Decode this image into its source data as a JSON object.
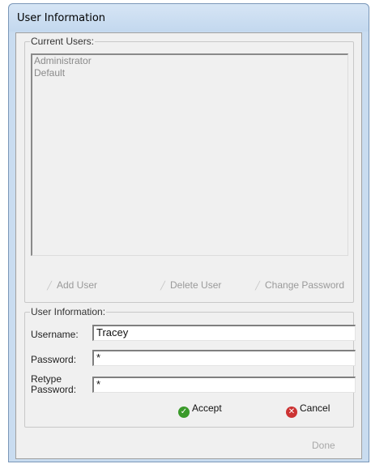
{
  "window": {
    "title": "User Information"
  },
  "users_group": {
    "legend": "Current Users:",
    "users": [
      "Administrator",
      "Default"
    ],
    "buttons": {
      "add_user": {
        "label": "Add User",
        "enabled": false
      },
      "delete_user": {
        "label": "Delete User",
        "enabled": false
      },
      "change_password": {
        "label": "Change Password",
        "enabled": false
      }
    }
  },
  "info_group": {
    "legend": "User Information:",
    "username": {
      "label": "Username:",
      "value": "Tracey"
    },
    "password": {
      "label": "Password:",
      "value": "*"
    },
    "retype_password": {
      "label_line1": "Retype",
      "label_line2": "Password:",
      "value": "*"
    },
    "accept": {
      "label": "Accept"
    },
    "cancel": {
      "label": "Cancel"
    }
  },
  "done": {
    "label": "Done",
    "enabled": false
  },
  "colors": {
    "accept_green": "#3a9a2a",
    "cancel_red": "#cc3333",
    "frame": "#c9dcf0"
  },
  "icons": {
    "accept": "check-circle-icon",
    "cancel": "x-circle-icon",
    "disabled_buttons": "pencil-icon"
  }
}
